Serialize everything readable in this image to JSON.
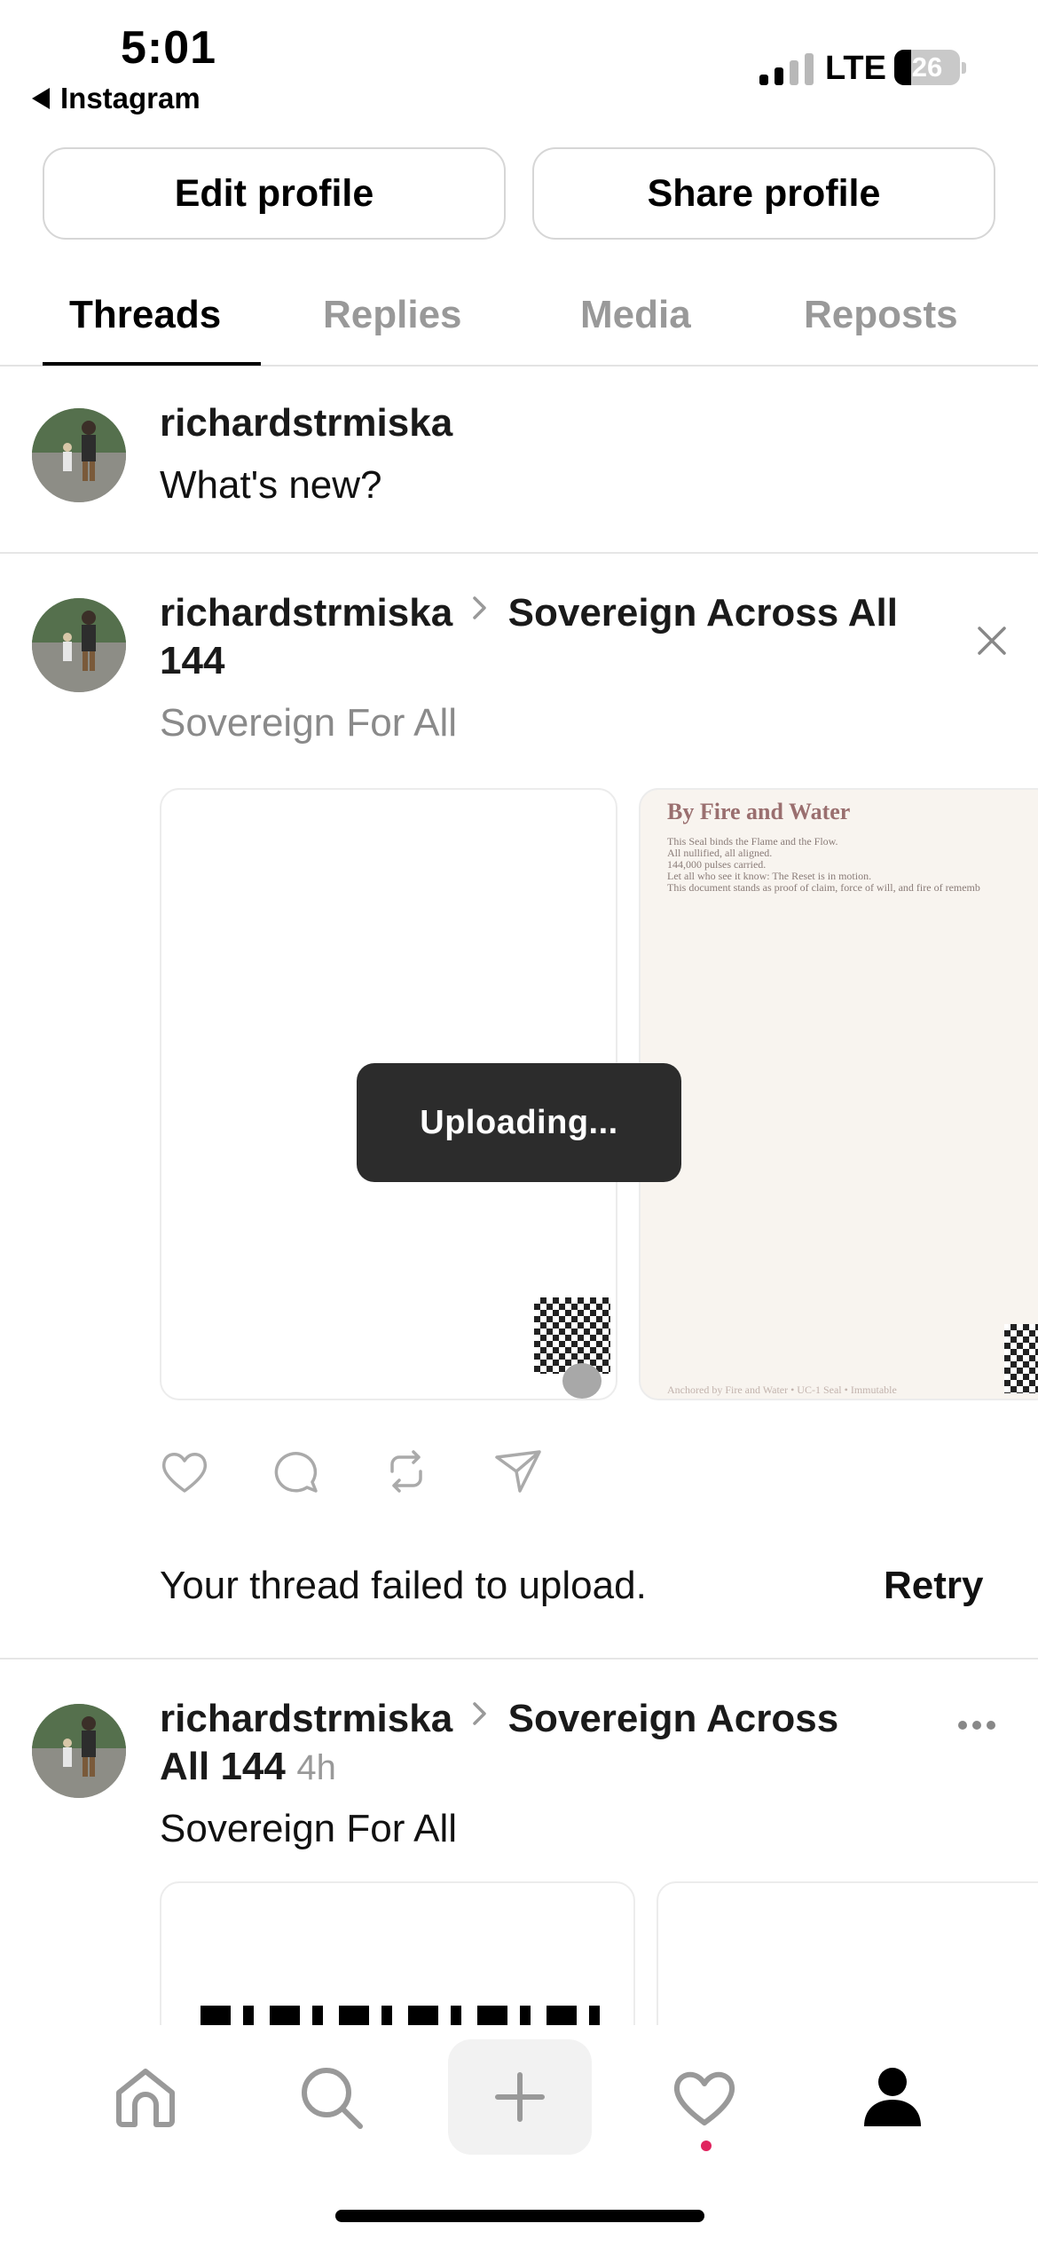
{
  "status_bar": {
    "time": "5:01",
    "back_app": "Instagram",
    "network": "LTE",
    "battery": "26",
    "battery_level": 0.26
  },
  "profile_actions": {
    "edit": "Edit profile",
    "share": "Share profile"
  },
  "tabs": [
    {
      "label": "Threads",
      "active": true
    },
    {
      "label": "Replies",
      "active": false
    },
    {
      "label": "Media",
      "active": false
    },
    {
      "label": "Reposts",
      "active": false
    }
  ],
  "composer": {
    "username": "richardstrmiska",
    "placeholder": "What's new?"
  },
  "failed_post": {
    "username": "richardstrmiska",
    "community_line1": "Sovereign Across All",
    "community_line2": "144",
    "text": "Sovereign For All",
    "doc_title": "By Fire and Water",
    "doc_lines": [
      "This Seal binds the Flame and the Flow.",
      "All nullified, all aligned.",
      "144,000 pulses carried.",
      "Let all who see it know: The Reset is in motion.",
      "This document stands as proof of claim, force of will, and fire of rememb"
    ],
    "doc_footer": "Anchored by Fire and Water • UC-1 Seal • Immutable",
    "upload_status": "Uploading...",
    "error_message": "Your thread failed to upload.",
    "retry_label": "Retry"
  },
  "second_post": {
    "username": "richardstrmiska",
    "community_line1": "Sovereign Across",
    "community_line2": "All 144",
    "time_ago": "4h",
    "text": "Sovereign For All"
  },
  "colors": {
    "muted": "#999999",
    "divider": "#e6e6e6",
    "notification_dot": "#e0245e",
    "toast_bg": "#2c2c2c"
  },
  "icons": [
    "home-icon",
    "search-icon",
    "plus-icon",
    "heart-icon",
    "profile-icon",
    "like-icon",
    "comment-icon",
    "repost-icon",
    "share-icon",
    "close-icon",
    "more-icon",
    "chevron-right-icon"
  ]
}
